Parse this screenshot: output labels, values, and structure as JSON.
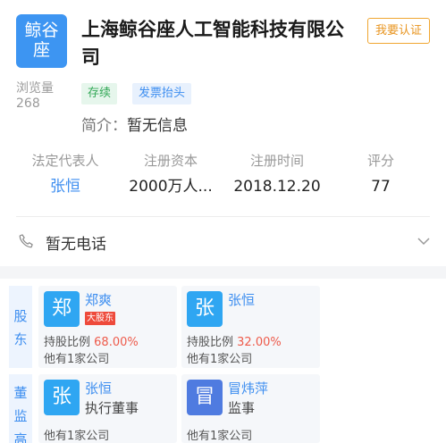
{
  "company": {
    "logo_line1": "鲸谷",
    "logo_line2": "座",
    "name": "上海鲸谷座人工智能科技有限公司",
    "views_label": "浏览量",
    "views_count": "268",
    "claim_label": "我要认证",
    "tags": [
      "存续",
      "发票抬头"
    ],
    "intro_label": "简介：",
    "intro_value": "暂无信息"
  },
  "stats": [
    {
      "label": "法定代表人",
      "value": "张恒"
    },
    {
      "label": "注册资本",
      "value": "2000万人..."
    },
    {
      "label": "注册时间",
      "value": "2018.12.20"
    },
    {
      "label": "评分",
      "value": "77"
    }
  ],
  "phone": {
    "text": "暂无电话",
    "icon": "phone-icon",
    "expand_icon": "chevron-down-icon"
  },
  "shareholders": {
    "section_label_1": "股",
    "section_label_2": "东",
    "cards": [
      {
        "avatar": "郑",
        "name": "郑爽",
        "badge": "大股东",
        "share_label": "持股比例",
        "share_value": "68.00%",
        "companies": "他有1家公司"
      },
      {
        "avatar": "张",
        "name": "张恒",
        "share_label": "持股比例",
        "share_value": "32.00%",
        "companies": "他有1家公司"
      }
    ]
  },
  "board": {
    "section_label_1": "董",
    "section_label_2": "监",
    "section_label_3": "高",
    "cards": [
      {
        "avatar": "张",
        "name": "张恒",
        "role": "执行董事",
        "companies": "他有1家公司"
      },
      {
        "avatar": "冒",
        "name": "冒炜萍",
        "role": "监事",
        "companies": "他有1家公司"
      }
    ]
  },
  "colors": {
    "brand_blue": "#3d8ef0",
    "status_green": "#33a857",
    "claim_orange": "#e8941f",
    "badge_red": "#ee4a3b"
  }
}
